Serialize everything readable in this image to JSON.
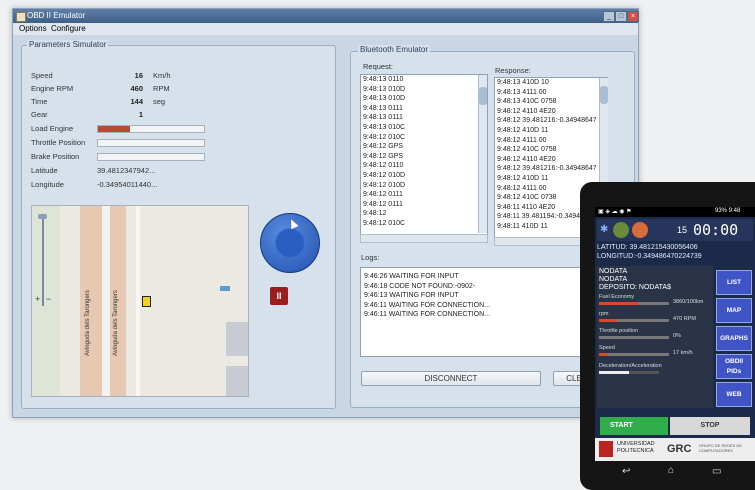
{
  "window": {
    "title": "OBD II Emulator",
    "menu": [
      "Options",
      "Configure"
    ]
  },
  "params": {
    "title": "Parameters Simulator",
    "rows": [
      {
        "label": "Speed",
        "value": "16",
        "unit": "Km/h"
      },
      {
        "label": "Engine RPM",
        "value": "460",
        "unit": "RPM"
      },
      {
        "label": "Time",
        "value": "144",
        "unit": "seg"
      },
      {
        "label": "Gear",
        "value": "1",
        "unit": ""
      }
    ],
    "bars": [
      {
        "label": "Load Engine",
        "fill": 0.3
      },
      {
        "label": "Throttle Position",
        "fill": 0.0
      },
      {
        "label": "Brake Position",
        "fill": 0.0
      }
    ],
    "latitude_label": "Latitude",
    "latitude": "39.4812347942...",
    "longitude_label": "Longitude",
    "longitude": "-0.34954011440..."
  },
  "map": {
    "street1": "Avinguda dels Tarongers",
    "street2": "Avinguda dels Tarongers",
    "zoom_plus": "+",
    "zoom_minus": "−"
  },
  "controls": {
    "stop_symbol": "II"
  },
  "bluetooth": {
    "title": "Bluetooth Emulator",
    "request_label": "Request:",
    "response_label": "Response:",
    "requests": [
      "9:48:13 0110",
      "9:48:13 010D",
      "9:48:13 010D",
      "9:48:13 0111",
      "9:48:13 0111",
      "9:48:13 010C",
      "9:48:12 010C",
      "9:48:12 GPS",
      "9:48:12 GPS",
      "9:48:12 0110",
      "9:48:12 010D",
      "9:48:12 010D",
      "9:48:12 0111",
      "9:48:12 0111",
      "9:48:12",
      "9:48:12 010C"
    ],
    "responses": [
      "9:48:13 410D 10",
      "9:48:13 4111 00",
      "9:48:13 410C 0758",
      "9:48:12 4110 4E20",
      "9:48:12 39.481216:-0.34948647",
      "9:48:12 410D 11",
      "9:48:12 4111 00",
      "9:48:12 410C 0758",
      "9:48:12 4110 4E20",
      "9:48:12 39.481216:-0.34948647",
      "9:48:12 410D 11",
      "9:48:12 4111 00",
      "9:48:12 410C 0738",
      "9:48:11 4110 4E20",
      "9:48:11 39.481194:-0.3494",
      "9:48:11 410D 11"
    ],
    "logs_label": "Logs:",
    "logs": [
      "9:46:26  WAITING FOR INPUT",
      "9:46:18  CODE NOT FOUND:-0902-",
      "9:46:13  WAITING FOR INPUT",
      "9:46:11  WAITING FOR CONNECTION...",
      "9:46:11  WAITING FOR CONNECTION..."
    ],
    "disconnect_label": "DISCONNECT",
    "clear_label": "CLE"
  },
  "phone": {
    "status_right": "93% 9:48",
    "counter": "15",
    "timer": "00:00",
    "latitude": "LATITUD: 39.481215430056406",
    "longitude": "LONGITUD:-0.349486470224739",
    "nodata1": "NODATA",
    "nodata2": "NODATA",
    "deposito": "DEPOSITO: NODATA$",
    "gauges": [
      {
        "label": "Fuel Economy",
        "value": "3860/100km",
        "fill": 0.55
      },
      {
        "label": "rpm",
        "value": "470 RPM",
        "fill": 0.25
      },
      {
        "label": "Throttle position",
        "value": "0%",
        "fill": 0.0
      },
      {
        "label": "Speed",
        "value": "17 km/h",
        "fill": 0.12
      }
    ],
    "decel_label": "Deceleration/Acceleration",
    "side_buttons": [
      "LIST",
      "MAP",
      "GRAPHS",
      "OBDII PIDs",
      "WEB"
    ],
    "start_label": "START",
    "stop_label": "STOP",
    "footer1": "UNIVERSIDAD",
    "footer2": "POLITECNICA",
    "footer3": "GRC",
    "footer4": "GRUPO DE REDES DE COMPUTADORES"
  }
}
